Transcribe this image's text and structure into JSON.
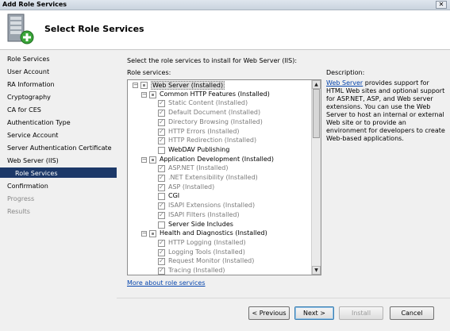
{
  "window": {
    "title": "Add Role Services",
    "close_glyph": "✕"
  },
  "header": {
    "heading": "Select Role Services",
    "icon": "server-add-icon"
  },
  "nav": {
    "items": [
      {
        "label": "Role Services",
        "state": "normal"
      },
      {
        "label": "User Account",
        "state": "normal"
      },
      {
        "label": "RA Information",
        "state": "normal"
      },
      {
        "label": "Cryptography",
        "state": "normal"
      },
      {
        "label": "CA for CES",
        "state": "normal"
      },
      {
        "label": "Authentication Type",
        "state": "normal"
      },
      {
        "label": "Service Account",
        "state": "normal"
      },
      {
        "label": "Server Authentication Certificate",
        "state": "normal"
      },
      {
        "label": "Web Server (IIS)",
        "state": "normal"
      },
      {
        "label": "Role Services",
        "state": "selected"
      },
      {
        "label": "Confirmation",
        "state": "normal"
      },
      {
        "label": "Progress",
        "state": "disabled"
      },
      {
        "label": "Results",
        "state": "disabled"
      }
    ]
  },
  "content": {
    "intro": "Select the role services to install for Web Server (IIS):",
    "role_services_label": "Role services:",
    "description_label": "Description:",
    "description_link": "Web Server",
    "description_text": " provides support for HTML Web sites and optional support for ASP.NET, ASP, and Web server extensions. You can use the Web Server to host an internal or external Web site or to provide an environment for developers to create Web-based applications.",
    "more_link": "More about role services",
    "tree": [
      {
        "label": "Web Server  (Installed)",
        "level": 0,
        "expander": "−",
        "check": "partial",
        "dim": false,
        "selected": true
      },
      {
        "label": "Common HTTP Features  (Installed)",
        "level": 1,
        "expander": "−",
        "check": "partial",
        "dim": false
      },
      {
        "label": "Static Content  (Installed)",
        "level": 2,
        "check": "checked",
        "dim": true
      },
      {
        "label": "Default Document  (Installed)",
        "level": 2,
        "check": "checked",
        "dim": true
      },
      {
        "label": "Directory Browsing  (Installed)",
        "level": 2,
        "check": "checked",
        "dim": true
      },
      {
        "label": "HTTP Errors  (Installed)",
        "level": 2,
        "check": "checked",
        "dim": true
      },
      {
        "label": "HTTP Redirection  (Installed)",
        "level": 2,
        "check": "checked",
        "dim": true
      },
      {
        "label": "WebDAV Publishing",
        "level": 2,
        "check": "empty",
        "dim": false
      },
      {
        "label": "Application Development  (Installed)",
        "level": 1,
        "expander": "−",
        "check": "partial",
        "dim": false
      },
      {
        "label": "ASP.NET  (Installed)",
        "level": 2,
        "check": "checked",
        "dim": true
      },
      {
        "label": ".NET Extensibility  (Installed)",
        "level": 2,
        "check": "checked",
        "dim": true
      },
      {
        "label": "ASP  (Installed)",
        "level": 2,
        "check": "checked",
        "dim": true
      },
      {
        "label": "CGI",
        "level": 2,
        "check": "empty",
        "dim": false
      },
      {
        "label": "ISAPI Extensions  (Installed)",
        "level": 2,
        "check": "checked",
        "dim": true
      },
      {
        "label": "ISAPI Filters  (Installed)",
        "level": 2,
        "check": "checked",
        "dim": true
      },
      {
        "label": "Server Side Includes",
        "level": 2,
        "check": "empty",
        "dim": false
      },
      {
        "label": "Health and Diagnostics  (Installed)",
        "level": 1,
        "expander": "−",
        "check": "partial",
        "dim": false
      },
      {
        "label": "HTTP Logging  (Installed)",
        "level": 2,
        "check": "checked",
        "dim": true
      },
      {
        "label": "Logging Tools  (Installed)",
        "level": 2,
        "check": "checked",
        "dim": true
      },
      {
        "label": "Request Monitor  (Installed)",
        "level": 2,
        "check": "checked",
        "dim": true
      },
      {
        "label": "Tracing  (Installed)",
        "level": 2,
        "check": "checked",
        "dim": true
      }
    ]
  },
  "footer": {
    "previous": "< Previous",
    "next": "Next >",
    "install": "Install",
    "cancel": "Cancel"
  },
  "colors": {
    "nav_selected": "#1c3868",
    "link": "#0645ad"
  }
}
